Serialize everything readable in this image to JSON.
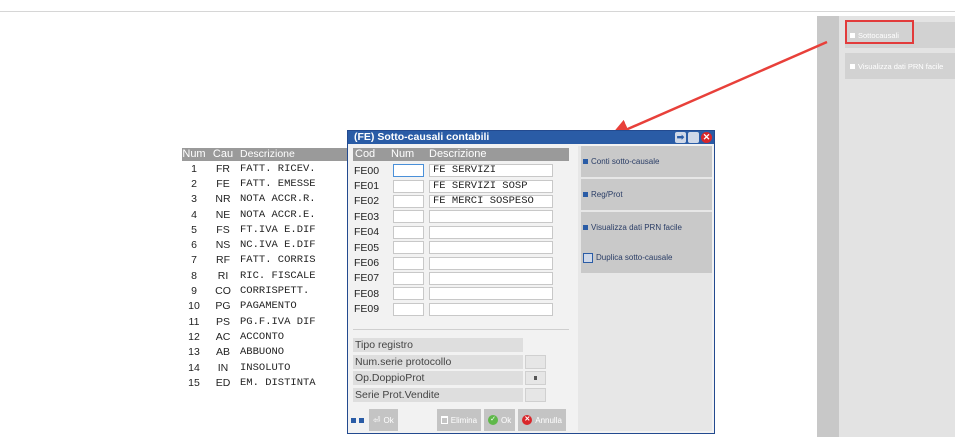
{
  "causali_table": {
    "headers": {
      "num": "Num",
      "cau": "Cau",
      "desc": "Descrizione"
    },
    "rows": [
      {
        "num": "1",
        "cau": "FR",
        "desc": "FATT. RICEV."
      },
      {
        "num": "2",
        "cau": "FE",
        "desc": "FATT. EMESSE"
      },
      {
        "num": "3",
        "cau": "NR",
        "desc": "NOTA ACCR.R."
      },
      {
        "num": "4",
        "cau": "NE",
        "desc": "NOTA ACCR.E."
      },
      {
        "num": "5",
        "cau": "FS",
        "desc": "FT.IVA E.DIF"
      },
      {
        "num": "6",
        "cau": "NS",
        "desc": "NC.IVA E.DIF"
      },
      {
        "num": "7",
        "cau": "RF",
        "desc": "FATT. CORRIS"
      },
      {
        "num": "8",
        "cau": "RI",
        "desc": "RIC. FISCALE"
      },
      {
        "num": "9",
        "cau": "CO",
        "desc": "CORRISPETT."
      },
      {
        "num": "10",
        "cau": "PG",
        "desc": "PAGAMENTO"
      },
      {
        "num": "11",
        "cau": "PS",
        "desc": "PG.F.IVA DIF"
      },
      {
        "num": "12",
        "cau": "AC",
        "desc": "ACCONTO"
      },
      {
        "num": "13",
        "cau": "AB",
        "desc": "ABBUONO"
      },
      {
        "num": "14",
        "cau": "IN",
        "desc": "INSOLUTO"
      },
      {
        "num": "15",
        "cau": "ED",
        "desc": "EM. DISTINTA"
      }
    ]
  },
  "right_panel": {
    "sottocausali_label": "Sottocausali",
    "visualizza_label": "Visualizza dati PRN facile"
  },
  "dialog": {
    "title": "(FE) Sotto-causali contabili",
    "grid_headers": {
      "cod": "Cod",
      "num": "Num",
      "desc": "Descrizione"
    },
    "rows": [
      {
        "cod": "FE00",
        "desc": "FE SERVIZI"
      },
      {
        "cod": "FE01",
        "desc": "FE SERVIZI SOSP"
      },
      {
        "cod": "FE02",
        "desc": "FE MERCI SOSPESO"
      },
      {
        "cod": "FE03",
        "desc": ""
      },
      {
        "cod": "FE04",
        "desc": ""
      },
      {
        "cod": "FE05",
        "desc": ""
      },
      {
        "cod": "FE06",
        "desc": ""
      },
      {
        "cod": "FE07",
        "desc": ""
      },
      {
        "cod": "FE08",
        "desc": ""
      },
      {
        "cod": "FE09",
        "desc": ""
      }
    ],
    "fields": {
      "tipo_registro": "Tipo registro",
      "num_serie_protocollo": "Num.serie protocollo",
      "op_doppio_prot": "Op.DoppioProt",
      "serie_prot_vendite": "Serie Prot.Vendite"
    },
    "side_buttons": {
      "conti": "Conti sotto-causale",
      "reg_prot": "Reg/Prot",
      "visualizza": "Visualizza dati PRN facile",
      "duplica": "Duplica sotto-causale"
    },
    "bottom_buttons": {
      "ok": "Ok",
      "elimina": "Elimina",
      "ok2": "Ok",
      "annulla": "Annulla"
    }
  },
  "colors": {
    "title_bar": "#2a5ca6",
    "highlight": "#e23b3b",
    "arrow": "#e8403a"
  }
}
